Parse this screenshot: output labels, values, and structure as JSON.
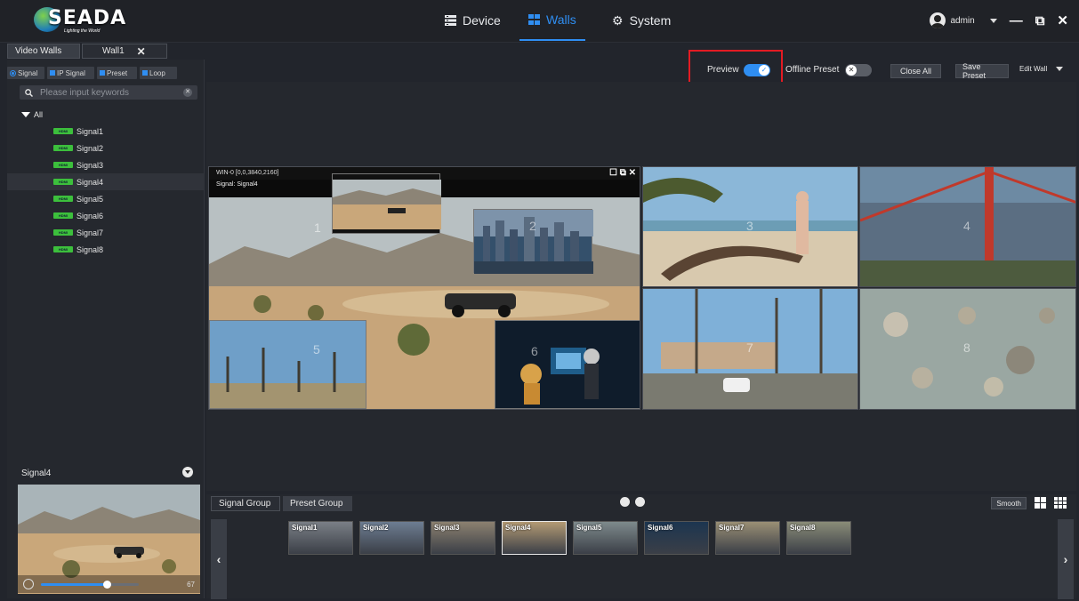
{
  "app": {
    "brand": "SEADA",
    "tagline": "Lighting the World"
  },
  "nav": {
    "items": [
      {
        "label": "Device",
        "icon": "device-icon"
      },
      {
        "label": "Walls",
        "icon": "walls-icon",
        "active": true
      },
      {
        "label": "System",
        "icon": "gear-icon"
      }
    ]
  },
  "user": {
    "name": "admin"
  },
  "tabs": [
    {
      "label": "Video Walls"
    },
    {
      "label": "Wall1",
      "active": true
    }
  ],
  "left_panel": {
    "filters": [
      {
        "label": "Signal",
        "icon": "radio-icon"
      },
      {
        "label": "IP Signal",
        "icon": "ip-signal-icon"
      },
      {
        "label": "Preset",
        "icon": "preset-icon"
      },
      {
        "label": "Loop",
        "icon": "loop-icon"
      }
    ],
    "search_placeholder": "Please input keywords",
    "tree_root": "All",
    "signals": [
      {
        "label": "Signal1"
      },
      {
        "label": "Signal2"
      },
      {
        "label": "Signal3"
      },
      {
        "label": "Signal4",
        "selected": true
      },
      {
        "label": "Signal5"
      },
      {
        "label": "Signal6"
      },
      {
        "label": "Signal7"
      },
      {
        "label": "Signal8"
      }
    ],
    "preview_label": "Signal4",
    "volume": 67
  },
  "toolbar": {
    "preview_label": "Preview",
    "preview_on": true,
    "offline_preset_label": "Offline Preset",
    "offline_preset_on": false,
    "close_all": "Close All",
    "save_preset": "Save Preset",
    "edit_wall": "Edit Wall"
  },
  "wall": {
    "window_title": "WIN-0 [0,0,3840,2160]",
    "window_signal": "Signal: Signal4",
    "screens": [
      "1",
      "2",
      "3",
      "4",
      "5",
      "6",
      "7",
      "8"
    ]
  },
  "bottom": {
    "tabs": [
      {
        "label": "Signal Group",
        "active": true
      },
      {
        "label": "Preset Group"
      }
    ],
    "smooth": "Smooth",
    "thumbs": [
      {
        "label": "Signal1",
        "color": "#7a7f86"
      },
      {
        "label": "Signal2",
        "color": "#6d7d92"
      },
      {
        "label": "Signal3",
        "color": "#8c8170"
      },
      {
        "label": "Signal4",
        "color": "#b39a74",
        "selected": true
      },
      {
        "label": "Signal5",
        "color": "#7e8a8c"
      },
      {
        "label": "Signal6",
        "color": "#1c3550"
      },
      {
        "label": "Signal7",
        "color": "#9a8f75"
      },
      {
        "label": "Signal8",
        "color": "#8a8c78"
      }
    ]
  },
  "colors": {
    "accent": "#2f8ef2",
    "highlight_box": "#e31b23",
    "hdmi_badge": "#3cbf3c"
  }
}
